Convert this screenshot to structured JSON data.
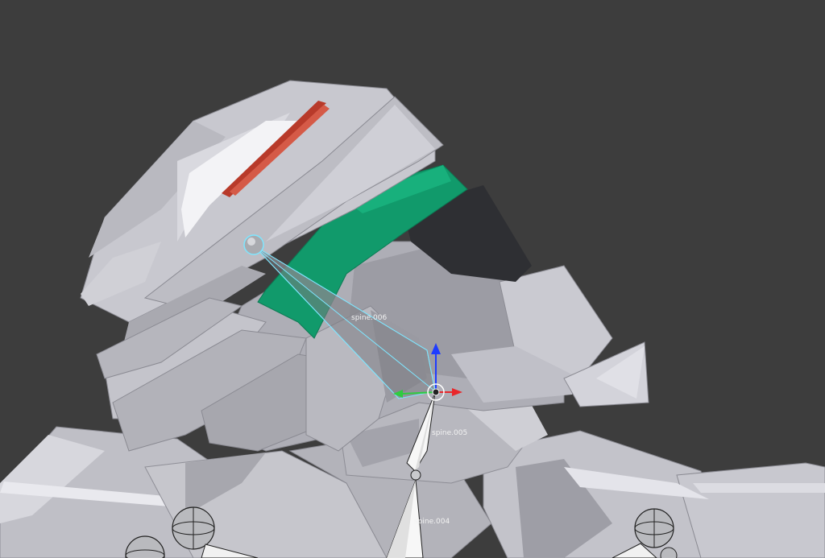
{
  "viewport": {
    "name": "3D Viewport",
    "background": "#3d3d3d"
  },
  "model": {
    "colors": {
      "armor_light": "#c9c9d0",
      "armor_mid": "#a8a8b0",
      "armor_dark": "#8a8a92",
      "armor_highlight": "#e8e8ee",
      "visor_green": "#119a6b",
      "visor_shadow": "#2e2f33",
      "stripe_red": "#b83a2a"
    }
  },
  "bones": {
    "selected": {
      "name": "spine.006",
      "outline_color": "#7fe6ff"
    },
    "list": [
      {
        "name": "spine.006"
      },
      {
        "name": "spine.005"
      },
      {
        "name": "spine.004"
      }
    ]
  },
  "gizmo": {
    "type": "translate",
    "axes": [
      {
        "axis": "x",
        "color": "#e8272b"
      },
      {
        "axis": "y",
        "color": "#2ecc40"
      },
      {
        "axis": "z",
        "color": "#1e3cff"
      }
    ]
  }
}
